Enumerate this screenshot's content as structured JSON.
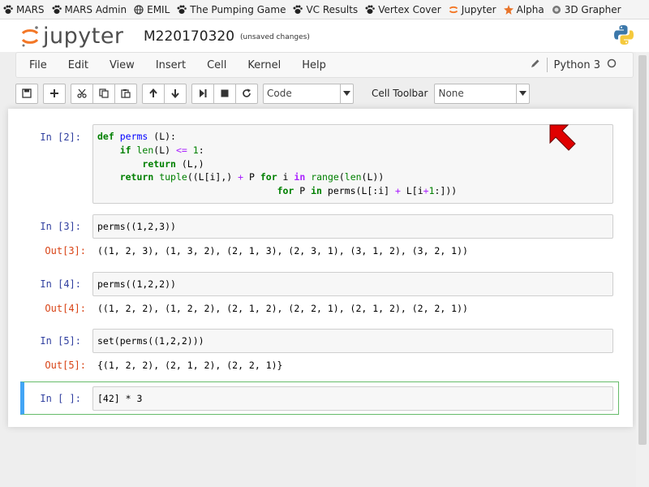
{
  "bookmarks": [
    {
      "label": "MARS",
      "icon": "paw-icon"
    },
    {
      "label": "MARS Admin",
      "icon": "paw-icon"
    },
    {
      "label": "EMIL",
      "icon": "globe-icon"
    },
    {
      "label": "The Pumping Game",
      "icon": "paw-icon"
    },
    {
      "label": "VC Results",
      "icon": "paw-icon"
    },
    {
      "label": "Vertex Cover",
      "icon": "paw-icon"
    },
    {
      "label": "Jupyter",
      "icon": "jupyter-icon"
    },
    {
      "label": "Alpha",
      "icon": "wolfram-icon"
    },
    {
      "label": "3D Grapher",
      "icon": "grapher-icon"
    }
  ],
  "header": {
    "logo_text": "jupyter",
    "notebook_name": "M220170320",
    "status": "(unsaved changes)"
  },
  "menubar": {
    "items": [
      "File",
      "Edit",
      "View",
      "Insert",
      "Cell",
      "Kernel",
      "Help"
    ],
    "kernel_name": "Python 3"
  },
  "toolbar": {
    "cell_type": "Code",
    "cell_toolbar_label": "Cell Toolbar",
    "cell_toolbar_value": "None"
  },
  "cells": {
    "c2": {
      "prompt": "In [2]:",
      "lines": [
        "def perms (L):",
        "    if len(L) <= 1:",
        "        return (L,)",
        "    return tuple((L[i],) + P for i in range(len(L))",
        "                                for P in perms(L[:i] + L[i+1:]))"
      ]
    },
    "c3": {
      "prompt": "In [3]:",
      "code": "perms((1,2,3))",
      "out_prompt": "Out[3]:",
      "output": "((1, 2, 3), (1, 3, 2), (2, 1, 3), (2, 3, 1), (3, 1, 2), (3, 2, 1))"
    },
    "c4": {
      "prompt": "In [4]:",
      "code": "perms((1,2,2))",
      "out_prompt": "Out[4]:",
      "output": "((1, 2, 2), (1, 2, 2), (2, 1, 2), (2, 2, 1), (2, 1, 2), (2, 2, 1))"
    },
    "c5": {
      "prompt": "In [5]:",
      "code": "set(perms((1,2,2)))",
      "out_prompt": "Out[5]:",
      "output": "{(1, 2, 2), (2, 1, 2), (2, 2, 1)}"
    },
    "c6": {
      "prompt": "In [ ]:",
      "code": "[42] * 3"
    }
  },
  "colors": {
    "in_prompt": "#303f9f",
    "out_prompt": "#d84315",
    "keyword": "#008000",
    "selected_border": "#66bb6a",
    "cursor": "#e00000"
  }
}
